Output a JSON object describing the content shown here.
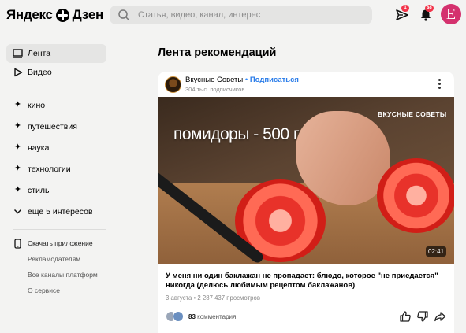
{
  "header": {
    "logo_left": "Яндекс",
    "logo_right": "Дзен",
    "search_placeholder": "Статья, видео, канал, интерес",
    "messages_badge": "1",
    "notifications_badge": "88",
    "avatar_letter": "E",
    "avatar_color": "#d4316e"
  },
  "sidebar": {
    "main": [
      {
        "label": "Лента",
        "icon": "monitor-icon"
      },
      {
        "label": "Видео",
        "icon": "play-icon"
      }
    ],
    "interests": [
      {
        "label": "кино"
      },
      {
        "label": "путешествия"
      },
      {
        "label": "наука"
      },
      {
        "label": "технологии"
      },
      {
        "label": "стиль"
      }
    ],
    "more_interests": "еще 5 интересов",
    "download_app": "Скачать приложение",
    "advertisers": "Рекламодателям",
    "all_channels": "Все каналы платформ",
    "about": "О сервисе"
  },
  "feed": {
    "title": "Лента рекомендаций",
    "card": {
      "channel_name": "Вкусные Советы",
      "dot": "•",
      "subscribe": "Подписаться",
      "subscribers": "304 тыс. подписчиков",
      "overlay_text": "помидоры - 500 г",
      "watermark": "ВКУСНЫЕ СОВЕТЫ",
      "duration": "02:41",
      "post_title": "У меня ни один баклажан не пропадает: блюдо, которое \"не приедается\" никогда (делюсь любимым рецептом баклажанов)",
      "meta": "3 августа • 2 287 437 просмотров",
      "comments_count": "83",
      "comments_label": "комментария"
    }
  },
  "colors": {
    "accent_blue": "#2b7de9",
    "badge_red": "#f2344a",
    "background": "#f3f3f2"
  }
}
